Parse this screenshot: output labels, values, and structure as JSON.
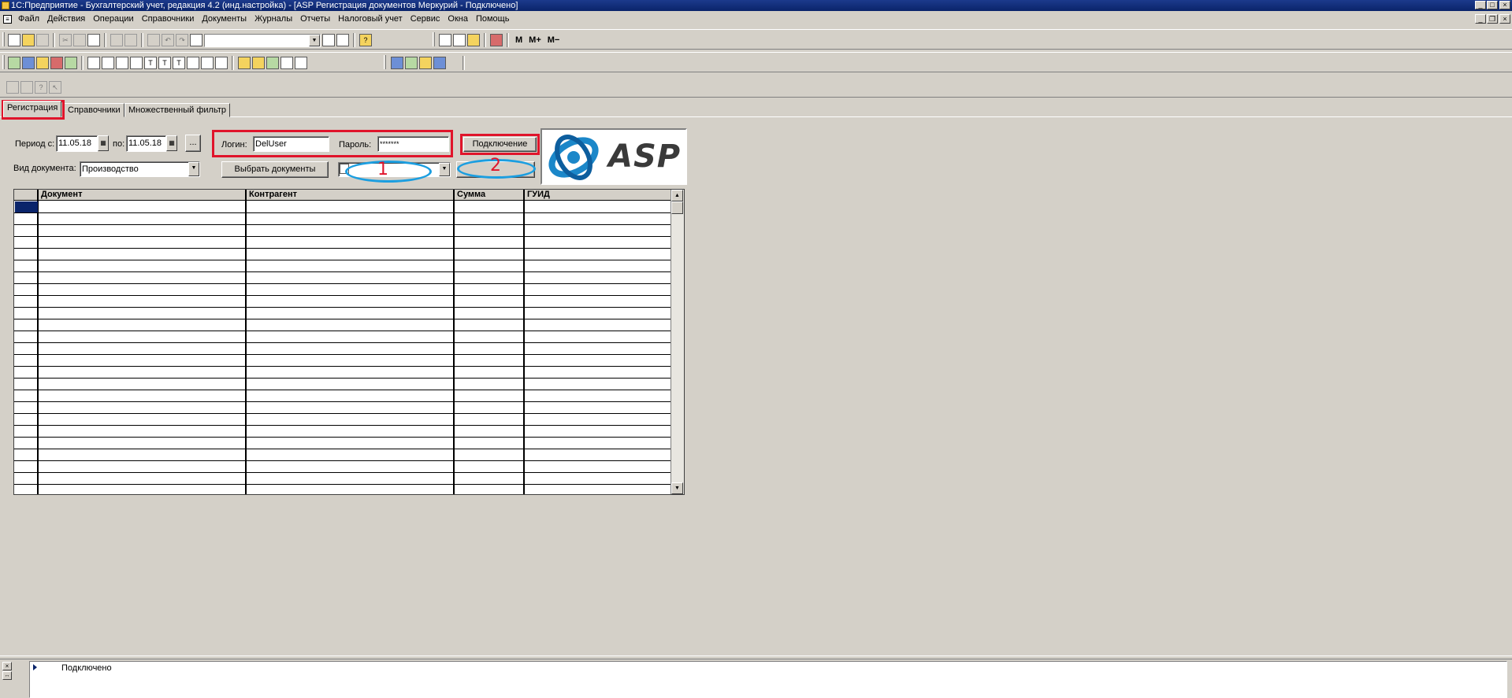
{
  "window": {
    "title": "1С:Предприятие - Бухгалтерский учет, редакция 4.2 (инд.настройка) - [ASP Регистрация документов Меркурий - Подключено]"
  },
  "menu": {
    "items": [
      "Файл",
      "Действия",
      "Операции",
      "Справочники",
      "Документы",
      "Журналы",
      "Отчеты",
      "Налоговый учет",
      "Сервис",
      "Окна",
      "Помощь"
    ]
  },
  "toolbar": {
    "m_label": "M",
    "m_plus_label": "M+",
    "m_minus_label": "M−"
  },
  "tabs": [
    {
      "label": "Регистрация",
      "active": true
    },
    {
      "label": "Справочники",
      "active": false
    },
    {
      "label": "Множественный фильтр",
      "active": false
    }
  ],
  "form": {
    "period_from_label": "Период с:",
    "period_from_value": "11.05.18",
    "period_to_label": "по:",
    "period_to_value": "11.05.18",
    "ellipsis_label": "...",
    "doc_type_label": "Вид документа:",
    "doc_type_value": "Производство",
    "select_docs_label": "Выбрать документы",
    "login_label": "Логин:",
    "login_value": "DelUser",
    "password_label": "Пароль:",
    "password_value": "*******",
    "connect_label": "Подключение",
    "logo_text": "ASP"
  },
  "annotations": {
    "marker_1": "1",
    "marker_2": "2",
    "accent_red": "#e0142b",
    "accent_blue": "#1b9ee0"
  },
  "grid": {
    "columns": [
      "",
      "Документ",
      "Контрагент",
      "Сумма",
      "ГУИД"
    ]
  },
  "status": {
    "message": "Подключено"
  }
}
